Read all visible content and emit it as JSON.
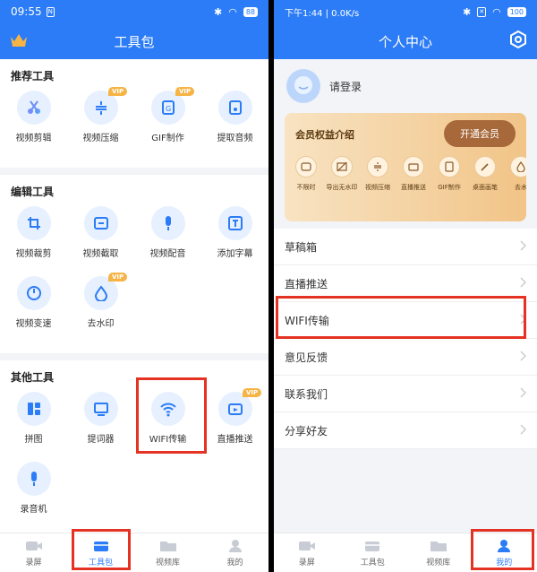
{
  "left": {
    "status": {
      "time": "09:55",
      "battery": "88"
    },
    "title": "工具包",
    "sections": [
      {
        "title": "推荐工具",
        "tools": [
          {
            "label": "视频剪辑",
            "icon": "scissors-icon",
            "vip": false
          },
          {
            "label": "视频压缩",
            "icon": "compress-icon",
            "vip": true
          },
          {
            "label": "GIF制作",
            "icon": "gif-icon",
            "vip": true
          },
          {
            "label": "提取音频",
            "icon": "music-icon",
            "vip": false
          }
        ]
      },
      {
        "title": "编辑工具",
        "tools": [
          {
            "label": "视频裁剪",
            "icon": "crop-icon",
            "vip": false
          },
          {
            "label": "视频截取",
            "icon": "cut-icon",
            "vip": false
          },
          {
            "label": "视频配音",
            "icon": "mic-icon",
            "vip": false
          },
          {
            "label": "添加字幕",
            "icon": "subtitle-icon",
            "vip": false
          },
          {
            "label": "视频变速",
            "icon": "speed-icon",
            "vip": false
          },
          {
            "label": "去水印",
            "icon": "drop-icon",
            "vip": true
          }
        ]
      },
      {
        "title": "其他工具",
        "tools": [
          {
            "label": "拼图",
            "icon": "puzzle-icon",
            "vip": false
          },
          {
            "label": "提词器",
            "icon": "prompter-icon",
            "vip": false
          },
          {
            "label": "WIFI传输",
            "icon": "wifi-icon",
            "vip": false
          },
          {
            "label": "直播推送",
            "icon": "live-icon",
            "vip": true
          },
          {
            "label": "录音机",
            "icon": "mic-icon",
            "vip": false
          }
        ]
      }
    ],
    "vip_badge": "VIP",
    "nav": [
      {
        "label": "录屏",
        "icon": "camera-icon"
      },
      {
        "label": "工具包",
        "icon": "toolbox-icon"
      },
      {
        "label": "视频库",
        "icon": "folder-icon"
      },
      {
        "label": "我的",
        "icon": "user-icon"
      }
    ],
    "active_nav": 1
  },
  "right": {
    "status": {
      "time": "下午1:44 | 0.0K/s",
      "battery": "100"
    },
    "title": "个人中心",
    "login": "请登录",
    "vip_card": {
      "title": "会员权益介绍",
      "button": "开通会员",
      "perks": [
        "不限时",
        "导出无水印",
        "视频压缩",
        "直播推送",
        "GIF制作",
        "桌面画笔",
        "去水"
      ]
    },
    "menu": [
      "草稿箱",
      "直播推送",
      "WIFI传输",
      "意见反馈",
      "联系我们",
      "分享好友"
    ],
    "nav": [
      {
        "label": "录屏",
        "icon": "camera-icon"
      },
      {
        "label": "工具包",
        "icon": "toolbox-icon"
      },
      {
        "label": "视频库",
        "icon": "folder-icon"
      },
      {
        "label": "我的",
        "icon": "user-icon"
      }
    ],
    "active_nav": 3
  },
  "colors": {
    "primary": "#2b7cf6",
    "highlight": "#e53323",
    "vip": "#f5b445"
  }
}
